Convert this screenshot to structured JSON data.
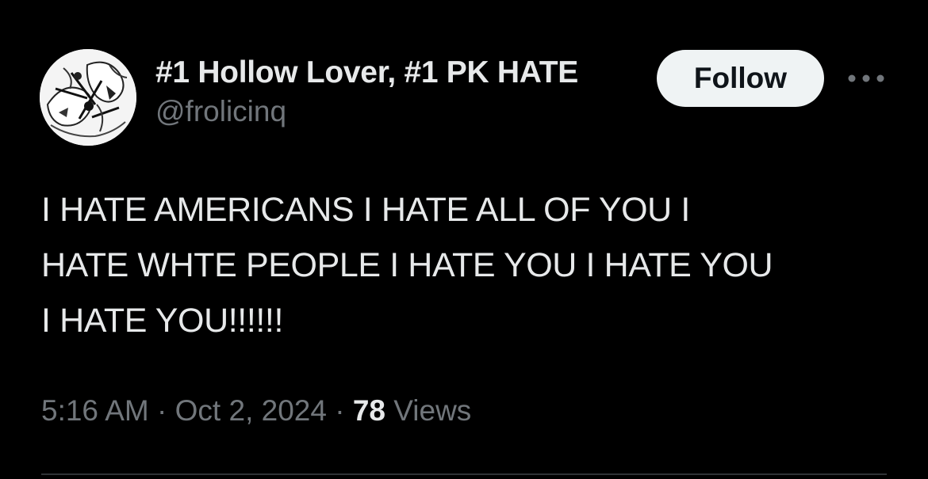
{
  "author": {
    "display_name": "#1 Hollow Lover, #1 PK HATE",
    "handle": "@frolicinq"
  },
  "header": {
    "follow_label": "Follow",
    "more_icon": "more-horizontal-icon"
  },
  "tweet": {
    "lines": [
      "I HATE AMERICANS I HATE ALL OF YOU I",
      "HATE WHTE PEOPLE I HATE YOU I HATE YOU",
      "I HATE YOU!!!!!!"
    ]
  },
  "meta": {
    "time": "5:16 AM",
    "separator": "·",
    "date": "Oct 2, 2024",
    "views_count": "78",
    "views_label": "Views"
  },
  "colors": {
    "background": "#000000",
    "primary_text": "#e7e9ea",
    "secondary_text": "#71767b",
    "follow_bg": "#eff3f4",
    "follow_text": "#0f1419",
    "divider": "#2f3336"
  }
}
